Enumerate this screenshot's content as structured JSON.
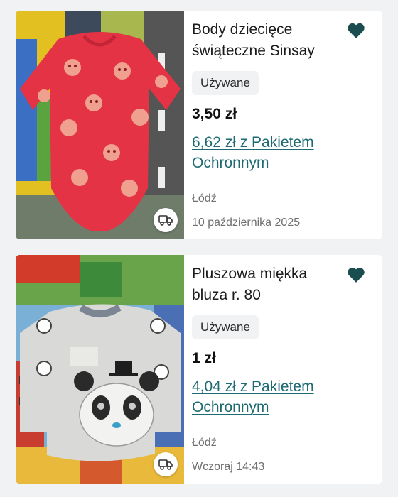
{
  "listings": [
    {
      "title": "Body dziecięce\nświąteczne Sinsay",
      "condition": "Używane",
      "price": "3,50 zł",
      "protected_price": "6,62 zł z Pakietem Ochronnym",
      "location": "Łódź",
      "date": "10 października 2025",
      "favorite_icon": "heart-icon",
      "delivery_icon": "delivery-truck-icon",
      "accent_color": "#1d6a72"
    },
    {
      "title": "Pluszowa miękka\nbluza r. 80",
      "condition": "Używane",
      "price": "1 zł",
      "protected_price": "4,04 zł z Pakietem Ochronnym",
      "location": "Łódź",
      "date": "Wczoraj 14:43",
      "favorite_icon": "heart-icon",
      "delivery_icon": "delivery-truck-icon",
      "accent_color": "#1d6a72"
    }
  ]
}
